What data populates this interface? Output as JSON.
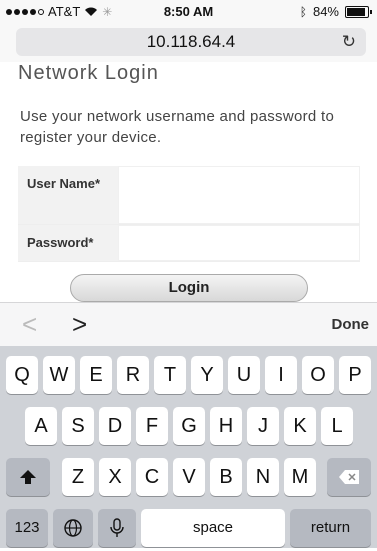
{
  "status_bar": {
    "carrier": "AT&T",
    "time": "8:50 AM",
    "battery": "84%",
    "battery_level": 0.84
  },
  "browser": {
    "address": "10.118.64.4"
  },
  "page": {
    "title": "Network Login",
    "subtitle": "Use your network username and password to register your device.",
    "fields": {
      "username_label": "User Name",
      "password_label": "Password",
      "required_marker": "*"
    },
    "login_button": "Login"
  },
  "toolbar": {
    "prev": "<",
    "next": ">",
    "done": "Done"
  },
  "keyboard": {
    "row1": [
      "Q",
      "W",
      "E",
      "R",
      "T",
      "Y",
      "U",
      "I",
      "O",
      "P"
    ],
    "row2": [
      "A",
      "S",
      "D",
      "F",
      "G",
      "H",
      "J",
      "K",
      "L"
    ],
    "row3": [
      "Z",
      "X",
      "C",
      "V",
      "B",
      "N",
      "M"
    ],
    "numbers": "123",
    "space": "space",
    "return": "return"
  },
  "colors": {
    "keyboard_bg": "#cfd2d7",
    "key_bg": "#ffffff",
    "dark_key_bg": "#b5b9c1"
  }
}
